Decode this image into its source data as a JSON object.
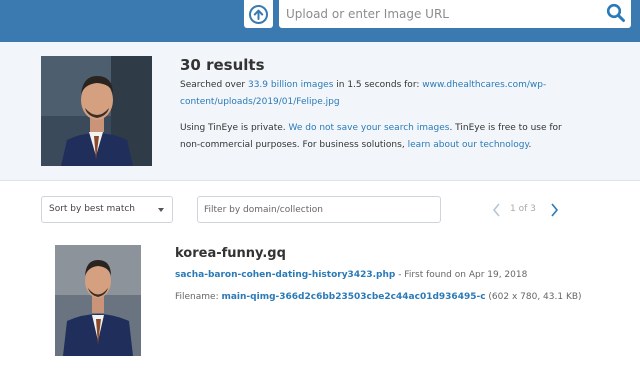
{
  "header": {
    "upload_icon": "upload-arrow-icon",
    "search_placeholder": "Upload or enter Image URL",
    "search_icon": "search-icon",
    "bar_color": "#3a7ab0"
  },
  "summary": {
    "results_count": "30 results",
    "searched_prefix": "Searched over ",
    "index_size": "33.9 billion images",
    "searched_mid": " in 1.5 seconds for: ",
    "query_url": "www.dhealthcares.com/wp-content/uploads/2019/01/Felipe.jpg",
    "privacy_prefix": "Using TinEye is private. ",
    "privacy_link": "We do not save your search images",
    "privacy_mid": ". TinEye is free to use for non-commercial purposes. For business solutions, ",
    "business_link": "learn about our technology",
    "privacy_suffix": ".",
    "link_color": "#2a7ab8"
  },
  "controls": {
    "sort_label": "Sort by best match",
    "filter_placeholder": "Filter by domain/collection",
    "pager_text": "1 of 3"
  },
  "results": [
    {
      "domain": "korea-funny.gq",
      "page_link": "sacha-baron-cohen-dating-history3423.php",
      "first_found": " - First found on Apr 19, 2018",
      "filename_label": "Filename: ",
      "filename": "main-qimg-366d2c6bb23503cbe2c44ac01d936495-c",
      "file_info": " (602 x 780, 43.1 KB)"
    }
  ]
}
